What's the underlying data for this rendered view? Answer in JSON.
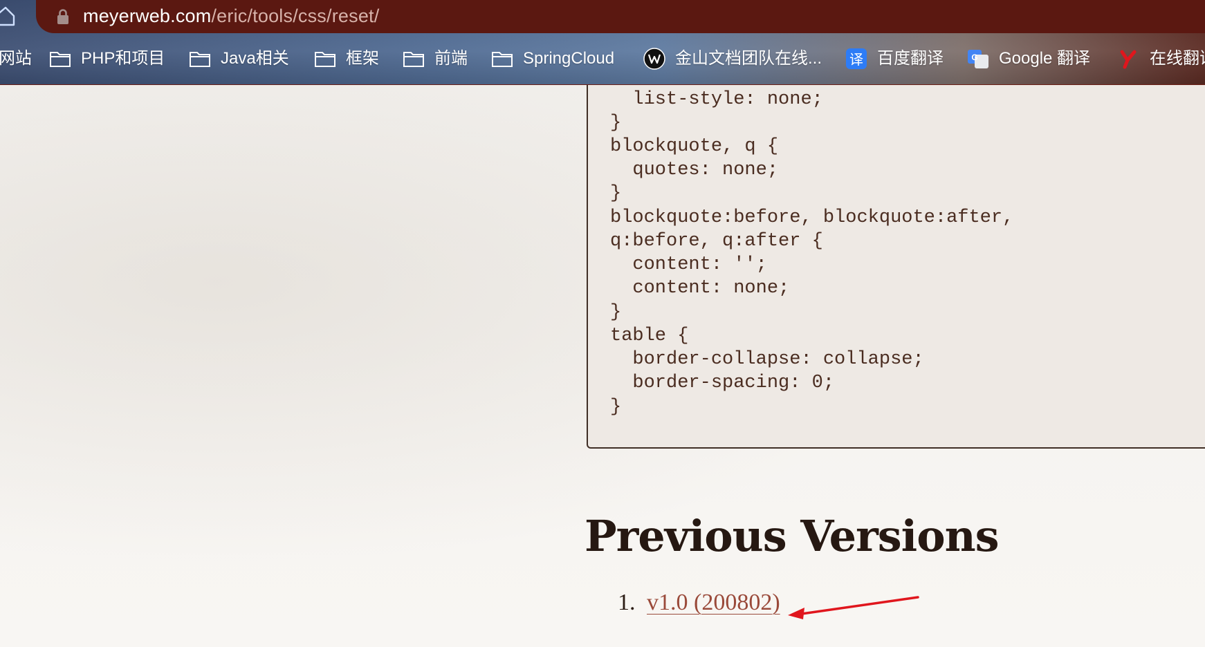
{
  "browser": {
    "url_host": "meyerweb.com",
    "url_path": "/eric/tools/css/reset/"
  },
  "bookmarks": [
    {
      "label": "网站",
      "icon": "none"
    },
    {
      "label": "PHP和项目",
      "icon": "folder-icon"
    },
    {
      "label": "Java相关",
      "icon": "folder-icon"
    },
    {
      "label": "框架",
      "icon": "folder-icon"
    },
    {
      "label": "前端",
      "icon": "folder-icon"
    },
    {
      "label": "SpringCloud",
      "icon": "folder-icon"
    },
    {
      "label": "金山文档团队在线...",
      "icon": "wps-icon"
    },
    {
      "label": "百度翻译",
      "icon": "baidu-translate-icon"
    },
    {
      "label": "Google 翻译",
      "icon": "google-translate-icon"
    },
    {
      "label": "在线翻译",
      "icon": "youdao-icon"
    }
  ],
  "code_lines": [
    "  list-style: none;",
    "}",
    "blockquote, q {",
    "  quotes: none;",
    "}",
    "blockquote:before, blockquote:after,",
    "q:before, q:after {",
    "  content: '';",
    "  content: none;",
    "}",
    "table {",
    "  border-collapse: collapse;",
    "  border-spacing: 0;",
    "}"
  ],
  "previous_versions": {
    "title": "Previous Versions",
    "items": [
      {
        "number": "1.",
        "label": "v1.0 (200802)"
      }
    ]
  },
  "colors": {
    "address_bar": "#5b1811",
    "link": "#9a4a3a",
    "code_text": "#4a2c20",
    "annotation_arrow": "#e0161d"
  }
}
